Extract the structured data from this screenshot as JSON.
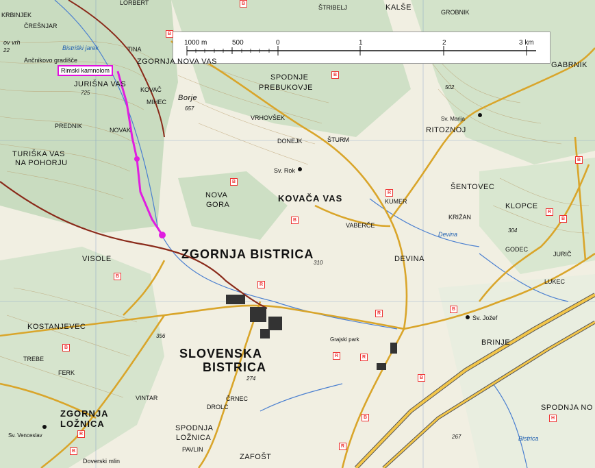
{
  "map": {
    "scale_bar": {
      "ticks": [
        "1000 m",
        "500",
        "0",
        "1",
        "2",
        "3 km"
      ]
    },
    "highlight_label": "Rimski kamnolom",
    "places": {
      "krbinjek": "KRBINJEK",
      "cresnjar": "ČREŠNJAR",
      "ov_vrh": "ov vrh",
      "elev_22": "22",
      "bistriski_jarek": "Bistriški jarek",
      "ancnikovo": "Ančnikovo gradišče",
      "tina": "TINA",
      "zg_nova_vas": "ZGORNJA NOVA VAS",
      "jurisna_vas": "JURIŠNA VAS",
      "elev_725": "725",
      "kovac": "KOVAČ",
      "mihec": "MIHEC",
      "borje": "Borje",
      "elev_657": "657",
      "prednik": "PREDNIK",
      "novak": "NOVAK",
      "turiska_vas": "TURIŠKA VAS",
      "na_pohorju": "NA POHORJU",
      "spodnje": "SPODNJE",
      "prebukovje": "PREBUKOVJE",
      "vrhovsek": "VRHOVŠEK",
      "donejk": "DONEJK",
      "sturm": "ŠTURM",
      "sv_rok": "Sv. Rok",
      "stribelj": "ŠTRIBELJ",
      "kalse": "KALŠE",
      "grobnik": "GROBNIK",
      "gabrnik": "GABRNIK",
      "elev_502": "502",
      "sv_marija": "Sv. Marija",
      "ritoznoj": "RITOZNOJ",
      "sentovec": "ŠENTOVEC",
      "klopce": "KLOPCE",
      "krizan": "KRIŽAN",
      "elev_304": "304",
      "godec": "GODEC",
      "juric": "JURIČ",
      "lukec": "LUKEC",
      "nova_gora_1": "NOVA",
      "nova_gora_2": "GORA",
      "kovaca_vas": "KOVAČA VAS",
      "kumer": "KUMER",
      "vaberce": "VABERČE",
      "zg_bistrica": "ZGORNJA BISTRICA",
      "elev_310": "310",
      "devina": "DEVINA",
      "devina_river": "Devina",
      "visole": "VISOLE",
      "kostanjevec": "KOSTANJEVEC",
      "elev_356": "356",
      "trebe": "TREBE",
      "ferk": "FERK",
      "slov_bistrica_1": "SLOVENSKA",
      "slov_bistrica_2": "BISTRICA",
      "elev_274": "274",
      "grajski_park": "Grajski park",
      "sv_jozef": "Sv. Jožef",
      "brinje": "BRINJE",
      "vintar": "VINTAR",
      "drolc": "DROLC",
      "crnec": "ČRNEC",
      "zg_loznica_1": "ZGORNJA",
      "zg_loznica_2": "LOŽNICA",
      "sv_venceslav": "Sv. Venceslav",
      "spodnja_loznica_1": "SPODNJA",
      "spodnja_loznica_2": "LOŽNICA",
      "pavlin": "PAVLIN",
      "zafost": "ZAFOŠT",
      "doverski_mlin": "Doverski mlin",
      "spodnja_no": "SPODNJA NO",
      "elev_267": "267",
      "bistrica_river": "Bistrica",
      "lorbert": "LORBERT"
    }
  }
}
